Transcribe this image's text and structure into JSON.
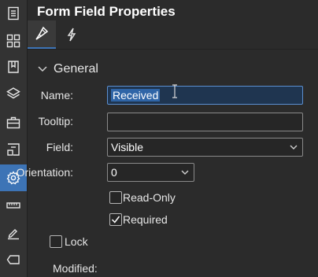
{
  "rail": {
    "items": [
      {
        "icon": "document-list-icon"
      },
      {
        "icon": "grid-icon"
      },
      {
        "icon": "bookmark-icon"
      },
      {
        "icon": "layers-icon"
      },
      {
        "icon": "briefcase-icon"
      },
      {
        "icon": "form-icon"
      },
      {
        "icon": "gear-icon",
        "active": true
      },
      {
        "icon": "ruler-icon"
      },
      {
        "icon": "signature-icon"
      },
      {
        "icon": "tag-icon"
      }
    ],
    "accent": "#3d74b6"
  },
  "panel": {
    "title": "Form Field Properties",
    "tabs": [
      {
        "icon": "brush-icon",
        "active": true
      },
      {
        "icon": "lightning-icon",
        "active": false
      }
    ],
    "section": {
      "title": "General",
      "expanded": true
    },
    "fields": {
      "name": {
        "label": "Name:",
        "value": "Received"
      },
      "tooltip": {
        "label": "Tooltip:",
        "value": ""
      },
      "field": {
        "label": "Field:",
        "value": "Visible"
      },
      "orientation": {
        "label": "Orientation:",
        "value": "0"
      }
    },
    "checkboxes": {
      "read_only": {
        "label": "Read-Only",
        "checked": false
      },
      "required": {
        "label": "Required",
        "checked": true
      },
      "lock": {
        "label": "Lock",
        "checked": false
      }
    },
    "modified": {
      "label": "Modified:"
    }
  }
}
